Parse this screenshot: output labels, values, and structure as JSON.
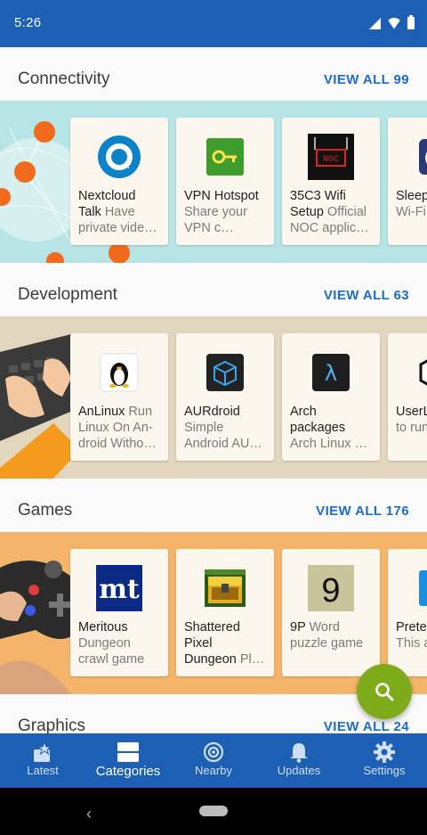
{
  "status_bar": {
    "time": "5:26"
  },
  "sections": [
    {
      "title": "Connectivity",
      "view_all": "VIEW ALL 99",
      "banner_color": "#b7e4e4",
      "apps": [
        {
          "name": "Nextcloud Talk",
          "summary": " Have private vide…",
          "icon": "nextcloud-talk-icon"
        },
        {
          "name": "VPN Hotspot",
          "summary": " Share your VPN c…",
          "icon": "vpn-hotspot-icon"
        },
        {
          "name": "35C3 Wifi Setup",
          "summary": " Official NOC applic…",
          "icon": "noc-wifi-icon"
        },
        {
          "name": "Sleep",
          "summary": " Disab Wi-Fi",
          "icon": "sleep-icon"
        }
      ]
    },
    {
      "title": "Development",
      "view_all": "VIEW ALL 63",
      "banner_color": "#e2d6be",
      "apps": [
        {
          "name": "AnLinux",
          "summary": " Run Linux On An-droid Witho…",
          "icon": "tux-penguin-icon"
        },
        {
          "name": "AURdroid",
          "summary": " Simple Android AU…",
          "icon": "aurdroid-box-icon"
        },
        {
          "name": "Arch packages",
          "summary": " Arch Linux …",
          "icon": "lambda-icon"
        },
        {
          "name": "UserL",
          "summary": " Easie to run",
          "icon": "userland-icon"
        }
      ]
    },
    {
      "title": "Games",
      "view_all": "VIEW ALL 176",
      "banner_color": "#f4b56a",
      "apps": [
        {
          "name": "Meritous",
          "summary": " Dungeon crawl game",
          "icon": "meritous-mt-icon"
        },
        {
          "name": "Shattered Pixel Dungeon",
          "summary": " Pl…",
          "icon": "treasure-chest-icon"
        },
        {
          "name": "9P",
          "summary": " Word puzzle game",
          "icon": "nine-p-icon"
        },
        {
          "name": "Prete",
          "summary": " You're This a",
          "icon": "pretend-icon"
        }
      ]
    },
    {
      "title": "Graphics",
      "view_all": "VIEW ALL 24"
    }
  ],
  "bottom_nav": [
    {
      "label": "Latest",
      "icon": "star-list-icon"
    },
    {
      "label": "Categories",
      "icon": "categories-icon"
    },
    {
      "label": "Nearby",
      "icon": "nearby-icon"
    },
    {
      "label": "Updates",
      "icon": "bell-icon"
    },
    {
      "label": "Settings",
      "icon": "gear-icon"
    }
  ],
  "fab": {
    "icon": "search-icon"
  },
  "colors": {
    "primary": "#1c5fb4",
    "accent": "#1c6dc9",
    "fab": "#7eab19"
  }
}
